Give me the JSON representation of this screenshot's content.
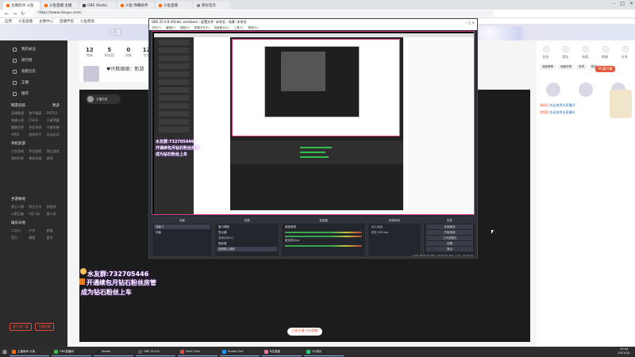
{
  "browser": {
    "tabs": [
      {
        "label": "主播房间 斗鱼",
        "color": "#ff6a00"
      },
      {
        "label": "斗鱼直播 主播",
        "color": "#ff6a00"
      },
      {
        "label": "OBS Studio",
        "color": "#444444"
      },
      {
        "label": "斗鱼 弹幕助手",
        "color": "#ff6a00"
      },
      {
        "label": "斗鱼直播",
        "color": "#ff6a00"
      },
      {
        "label": "新标签页",
        "color": "#888888"
      }
    ],
    "url": "https://www.douyu.com/",
    "bookmarks": [
      "应用",
      "斗鱼直播",
      "主播中心",
      "直播伴侣",
      "斗鱼帮助"
    ]
  },
  "douyu": {
    "banner_title": "直播",
    "sidebar": {
      "items": [
        "我的关注",
        "排行榜",
        "观看历史",
        "正播",
        "推荐"
      ],
      "section1": "网游竞技",
      "section1_more": "更多",
      "grid1": [
        "英雄联盟",
        "和平精英",
        "DOTA2",
        "穿越火线",
        "CSGO",
        "王者荣耀",
        "魔兽世界",
        "炉石传说",
        "守望先锋",
        "APEX",
        "绝地求生",
        "永劫无间"
      ],
      "section2": "单机热游",
      "grid2": [
        "主机游戏",
        "怀旧游戏",
        "独立游戏",
        "我的世界",
        "使命召唤",
        "原神"
      ],
      "section3": "手游休闲",
      "grid3": [
        "第五人格",
        "明日方舟",
        "阴阳师",
        "火影忍者",
        "QQ飞车",
        "狼人杀"
      ],
      "section4": "娱乐天地",
      "grid4": [
        "二次元",
        "户外",
        "颜值",
        "音乐",
        "舞蹈",
        "星秀"
      ],
      "bottom_buttons": [
        "客户端下载",
        "主播招募"
      ]
    },
    "stream": {
      "stats": [
        {
          "value": "12",
          "label": "等级"
        },
        {
          "value": "5",
          "label": "粉丝团"
        },
        {
          "value": "0",
          "label": "贡献"
        },
        {
          "value": "12",
          "label": "在线"
        }
      ],
      "anchor_name": "♥许默娘娘：新游"
    },
    "player": {
      "host_label": "主播在线",
      "overlay_line1": "水友群:732705446",
      "overlay_line2": "开通续包月钻石粉丝房管",
      "overlay_line3": "成为钻石粉丝上车",
      "subscribe_label": "订阅主播·开启提醒"
    },
    "right": {
      "icons": [
        "任务",
        "背包",
        "充值",
        "商城",
        "分享"
      ],
      "badge": "PC客户端",
      "tabs": [
        "贡献周榜",
        "贡献月榜",
        "贵宾",
        "粉丝"
      ],
      "chat": [
        {
          "tag": "[粉丝]",
          "text": "欢迎来到本直播间"
        },
        {
          "tag": "[房管]",
          "text": "欢迎来到本直播间"
        }
      ]
    }
  },
  "obs": {
    "title": "OBS 25.0.8 (64-bit, windows) - 配置文件: 未命名 - 场景: 未命名",
    "menu": [
      "文件(F)",
      "编辑(E)",
      "视图(V)",
      "配置文件(P)",
      "场景集合(S)",
      "工具(T)",
      "帮助(H)"
    ],
    "docks": {
      "scenes": {
        "header": "场景",
        "items": [
          "场景 2",
          "场景"
        ]
      },
      "sources": {
        "header": "来源",
        "items": [
          "窗口捕获",
          "显示器",
          "文本(GDI+)",
          "媒体源",
          "音频输入捕获",
          "图像 1"
        ]
      },
      "mixer": {
        "header": "混音器",
        "items": [
          "桌面音频",
          "麦克风/Aux"
        ]
      },
      "transitions": {
        "header": "转场特效",
        "items": [
          "淡入淡出",
          "时长 300 ms"
        ]
      },
      "controls": {
        "header": "控件",
        "items": [
          "开始推流",
          "开始录制",
          "工作室模式",
          "设置",
          "退出"
        ]
      }
    },
    "status": "LIVE: 00:00:00   REC: 00:00:00   CPU: 1.2%, 30.00 fps"
  },
  "taskbar": {
    "items": [
      {
        "label": "主播房间 斗鱼",
        "color": "#ff6a00"
      },
      {
        "label": "OBS直播间",
        "color": "#4caf50"
      },
      {
        "label": "Steam",
        "color": "#1b2838"
      },
      {
        "label": "OBS 25.0.8",
        "color": "#555555"
      },
      {
        "label": "Solid Chat",
        "color": "#e04c3c"
      },
      {
        "label": "Studio One",
        "color": "#2196f3"
      },
      {
        "label": "B站直播",
        "color": "#fb7299"
      },
      {
        "label": "QQ音乐",
        "color": "#31c27c"
      }
    ],
    "time": "20:04",
    "date": "2021/3/1"
  },
  "colors": {
    "accent": "#ff6a00",
    "obs_preview_border": "#d43c7a",
    "meter_green": "#3aa84a"
  }
}
